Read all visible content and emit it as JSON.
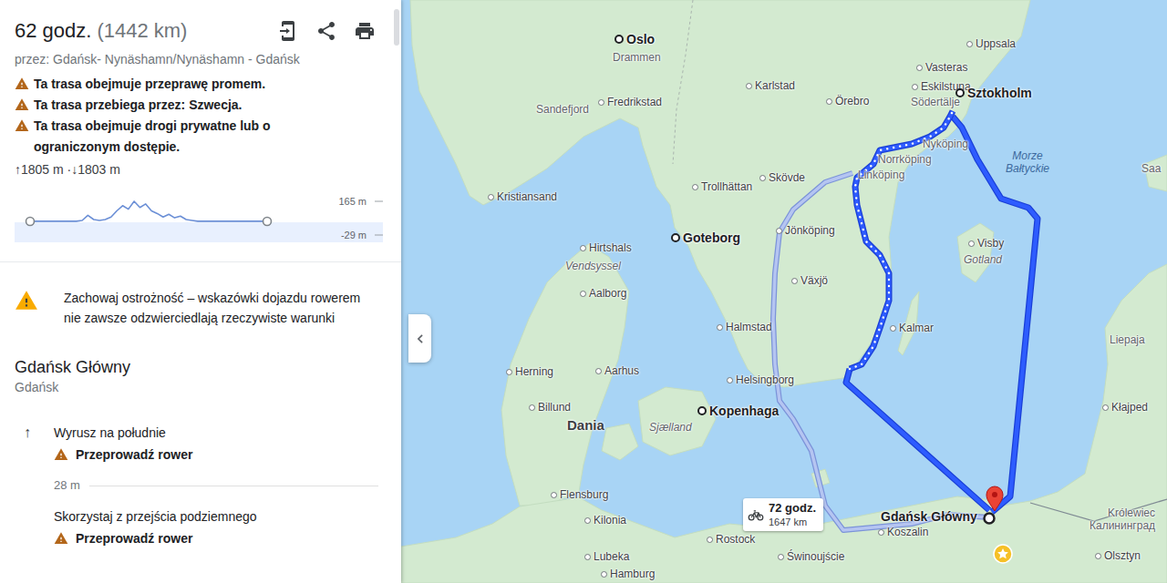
{
  "summary": {
    "duration": "62 godz.",
    "distance": "(1442 km)",
    "via": "przez: Gdańsk- Nynäshamn/Nynäshamn - Gdańsk"
  },
  "warnings": [
    "Ta trasa obejmuje przeprawę promem.",
    "Ta trasa przebiega przez: Szwecja.",
    "Ta trasa obejmuje drogi prywatne lub o ograniczonym dostępie."
  ],
  "elevation": {
    "gain_loss": "↑1805 m ·↓1803 m",
    "max_label": "165 m",
    "min_label": "-29 m",
    "max": 165,
    "min": -29,
    "values": [
      50,
      50,
      50,
      50,
      50,
      50,
      50,
      50,
      50,
      55,
      85,
      60,
      55,
      60,
      75,
      110,
      140,
      120,
      165,
      130,
      150,
      110,
      95,
      75,
      90,
      70,
      80,
      60,
      55,
      50,
      50,
      50,
      50,
      50,
      50,
      50,
      50,
      50,
      50,
      50,
      50,
      50
    ]
  },
  "notice": "Zachowaj ostrożność – wskazówki dojazdu rowerem nie zawsze odzwierciedlają rzeczywiste warunki",
  "start": {
    "name": "Gdańsk Główny",
    "city": "Gdańsk"
  },
  "steps": [
    {
      "arrow": "↑",
      "instruction": "Wyrusz na południe",
      "warning": "Przeprowadź rower",
      "distance": "28 m"
    },
    {
      "instruction": "Skorzystaj z przejścia podziemnego",
      "warning": "Przeprowadź rower"
    }
  ],
  "map": {
    "main_route": {
      "selected": true
    },
    "alt_route": {
      "duration": "72 godz.",
      "distance": "1647 km",
      "selected": false
    },
    "labels": [
      {
        "name": "Oslo",
        "kind": "capital"
      },
      {
        "name": "Drammen",
        "kind": "town"
      },
      {
        "name": "Uppsala",
        "kind": "city"
      },
      {
        "name": "Vasteras",
        "kind": "city"
      },
      {
        "name": "Karlstad",
        "kind": "city"
      },
      {
        "name": "Eskilstuna",
        "kind": "city"
      },
      {
        "name": "Sztokholm",
        "kind": "capital"
      },
      {
        "name": "Örebro",
        "kind": "city"
      },
      {
        "name": "Södertälje",
        "kind": "town"
      },
      {
        "name": "Sandefjord",
        "kind": "town"
      },
      {
        "name": "Fredrikstad",
        "kind": "city"
      },
      {
        "name": "Nyköping",
        "kind": "town"
      },
      {
        "name": "Norrköping",
        "kind": "town"
      },
      {
        "name": "Linköping",
        "kind": "town"
      },
      {
        "name": "Skövde",
        "kind": "city"
      },
      {
        "name": "Trollhättan",
        "kind": "city"
      },
      {
        "name": "Morze Bałtyckie",
        "kind": "water"
      },
      {
        "name": "Kristiansand",
        "kind": "city"
      },
      {
        "name": "Goteborg",
        "kind": "capital"
      },
      {
        "name": "Jönköping",
        "kind": "city"
      },
      {
        "name": "Hirtshals",
        "kind": "city"
      },
      {
        "name": "Vendsyssel",
        "kind": "region"
      },
      {
        "name": "Visby",
        "kind": "city"
      },
      {
        "name": "Gotland",
        "kind": "region"
      },
      {
        "name": "Aalborg",
        "kind": "city"
      },
      {
        "name": "Växjö",
        "kind": "city"
      },
      {
        "name": "Halmstad",
        "kind": "city"
      },
      {
        "name": "Kalmar",
        "kind": "city"
      },
      {
        "name": "Aarhus",
        "kind": "city"
      },
      {
        "name": "Herning",
        "kind": "city"
      },
      {
        "name": "Helsingborg",
        "kind": "city"
      },
      {
        "name": "Billund",
        "kind": "city"
      },
      {
        "name": "Kopenhaga",
        "kind": "capital"
      },
      {
        "name": "Dania",
        "kind": "country"
      },
      {
        "name": "Sjælland",
        "kind": "region"
      },
      {
        "name": "Flensburg",
        "kind": "city"
      },
      {
        "name": "Kilonia",
        "kind": "city"
      },
      {
        "name": "Rostock",
        "kind": "city"
      },
      {
        "name": "Lubeka",
        "kind": "city"
      },
      {
        "name": "Świnoujście",
        "kind": "city"
      },
      {
        "name": "Koszalin",
        "kind": "city"
      },
      {
        "name": "Gdańsk Główny",
        "kind": "poi"
      },
      {
        "name": "Olsztyn",
        "kind": "city"
      },
      {
        "name": "Królewiec",
        "kind": "town"
      },
      {
        "name": "Калининград",
        "kind": "town"
      },
      {
        "name": "Kłajped",
        "kind": "city"
      },
      {
        "name": "Liepaja",
        "kind": "town"
      },
      {
        "name": "Saa",
        "kind": "town"
      },
      {
        "name": "Hamburg",
        "kind": "city"
      }
    ]
  }
}
